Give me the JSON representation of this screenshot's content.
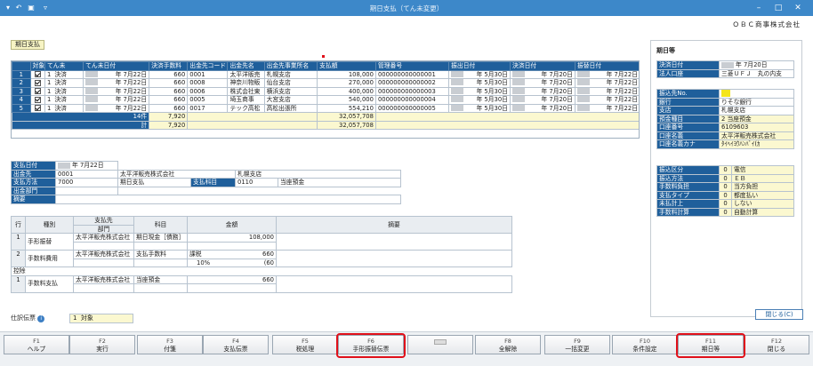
{
  "window": {
    "title": "期日支払（てん未変更）",
    "company": "ＯＢＣ商事株式会社"
  },
  "screen_tag": "期日支払",
  "main_grid": {
    "headers": [
      "対象",
      "てん未",
      "てん未日付",
      "決済手数料",
      "出金先コード",
      "出金先名",
      "出金先事業所名",
      "支払額",
      "管理番号",
      "振出日付",
      "決済日付",
      "振替日付"
    ],
    "rows": [
      {
        "no": "1",
        "kubun": "1",
        "status": "決済",
        "date": "年 7月22日",
        "fee": "660",
        "code": "0001",
        "name": "太平洋販売",
        "office": "札幌支店",
        "amount": "108,000",
        "mgmt": "000000000000001",
        "issue": "年 5月30日",
        "settle": "年 7月20日",
        "transfer": "年 7月22日"
      },
      {
        "no": "2",
        "kubun": "1",
        "status": "決済",
        "date": "年 7月22日",
        "fee": "660",
        "code": "0008",
        "name": "神奈川物販",
        "office": "仙台支店",
        "amount": "270,000",
        "mgmt": "000000000000002",
        "issue": "年 5月30日",
        "settle": "年 7月20日",
        "transfer": "年 7月22日"
      },
      {
        "no": "3",
        "kubun": "1",
        "status": "決済",
        "date": "年 7月22日",
        "fee": "660",
        "code": "0006",
        "name": "株式会社東",
        "office": "横浜支店",
        "amount": "400,000",
        "mgmt": "000000000000003",
        "issue": "年 5月30日",
        "settle": "年 7月20日",
        "transfer": "年 7月22日"
      },
      {
        "no": "4",
        "kubun": "1",
        "status": "決済",
        "date": "年 7月22日",
        "fee": "660",
        "code": "0005",
        "name": "埼玉商事",
        "office": "大宮支店",
        "amount": "540,000",
        "mgmt": "000000000000004",
        "issue": "年 5月30日",
        "settle": "年 7月20日",
        "transfer": "年 7月22日"
      },
      {
        "no": "5",
        "kubun": "1",
        "status": "決済",
        "date": "年 7月22日",
        "fee": "660",
        "code": "0017",
        "name": "テック高松",
        "office": "高松出張所",
        "amount": "554,210",
        "mgmt": "000000000000005",
        "issue": "年 5月30日",
        "settle": "年 7月20日",
        "transfer": "年 7月22日"
      }
    ],
    "count_label": "14件",
    "count_fee": "7,920",
    "count_amount": "32,057,708",
    "total_label": "計",
    "total_fee": "7,920",
    "total_amount": "32,057,708"
  },
  "header_form": {
    "pay_date_label": "支払日付",
    "pay_date": "年 7月22日",
    "dest_label": "出金先",
    "dest_code": "0001",
    "dest_name": "太平洋販売株式会社",
    "dest_office": "札幌支店",
    "method_label": "支払方法",
    "method_code": "7000",
    "method_name": "期日支払",
    "account_label": "支払科目",
    "account_code": "0110",
    "account_name": "当座預金",
    "dept_label": "出金部門",
    "memo_label": "摘要"
  },
  "detail": {
    "headers": {
      "row": "行",
      "type": "種別",
      "dest": "支払先",
      "dept": "部門",
      "subject": "科目",
      "amount": "金額",
      "memo": "摘要"
    },
    "rows": [
      {
        "no": "1",
        "type": "手形振替",
        "dest": "太平洋販売株式会社",
        "subject": "期日現金［債務］",
        "tax": "",
        "amount": "108,000"
      },
      {
        "no": "2",
        "type": "手数料費用",
        "dest": "太平洋販売株式会社",
        "subject": "支払手数料",
        "tax": "課税",
        "amount": "660",
        "rate": "10%",
        "tax_amount": "(60"
      }
    ],
    "deduct_label": "控除",
    "deduct": {
      "no": "1",
      "type": "手数料支払",
      "dest": "太平洋販売株式会社",
      "subject": "当座預金",
      "amount": "660"
    }
  },
  "voucher": {
    "label": "仕訳伝票",
    "value": "1",
    "text": "対象"
  },
  "side": {
    "title": "期日等",
    "rows1": [
      {
        "k": "決済日付",
        "v": "年 7月20日"
      },
      {
        "k": "法人口座",
        "v": "三菱ＵＦＪ　丸の内支"
      }
    ],
    "rows2": [
      {
        "k": "振込先No.",
        "v": ""
      },
      {
        "k": "銀行",
        "v": "りそな銀行"
      },
      {
        "k": "支店",
        "v": "札幌支店"
      },
      {
        "k": "預金種目",
        "v": "2  当座預金"
      },
      {
        "k": "口座番号",
        "v": "6109603"
      },
      {
        "k": "口座名義",
        "v": "太平洋販売株式会社"
      },
      {
        "k": "口座名義カナ",
        "v": "ﾀｲﾍｲﾖｳﾊﾝﾊﾞｲ(ｶ"
      }
    ],
    "rows3": [
      {
        "k": "振込区分",
        "c": "0",
        "v": "電信"
      },
      {
        "k": "振込方法",
        "c": "0",
        "v": "ＥＢ"
      },
      {
        "k": "手数料負担",
        "c": "0",
        "v": "当方負担"
      },
      {
        "k": "支払タイプ",
        "c": "0",
        "v": "都度払い"
      },
      {
        "k": "未払計上",
        "c": "0",
        "v": "しない"
      },
      {
        "k": "手数料計算",
        "c": "0",
        "v": "自動計算"
      }
    ],
    "close": "閉じる(C)"
  },
  "fkeys": [
    {
      "k": "F1",
      "l": "ヘルプ"
    },
    {
      "k": "F2",
      "l": "実行"
    },
    {
      "k": "F3",
      "l": "付箋"
    },
    {
      "k": "F4",
      "l": "支払伝票"
    },
    {
      "k": "F5",
      "l": "税処理"
    },
    {
      "k": "F6",
      "l": "手形振替伝票"
    },
    {
      "k": "",
      "l": ""
    },
    {
      "k": "F8",
      "l": "全解除"
    },
    {
      "k": "F9",
      "l": "一括変更"
    },
    {
      "k": "F10",
      "l": "条件設定"
    },
    {
      "k": "F11",
      "l": "期日等"
    },
    {
      "k": "F12",
      "l": "閉じる"
    }
  ]
}
